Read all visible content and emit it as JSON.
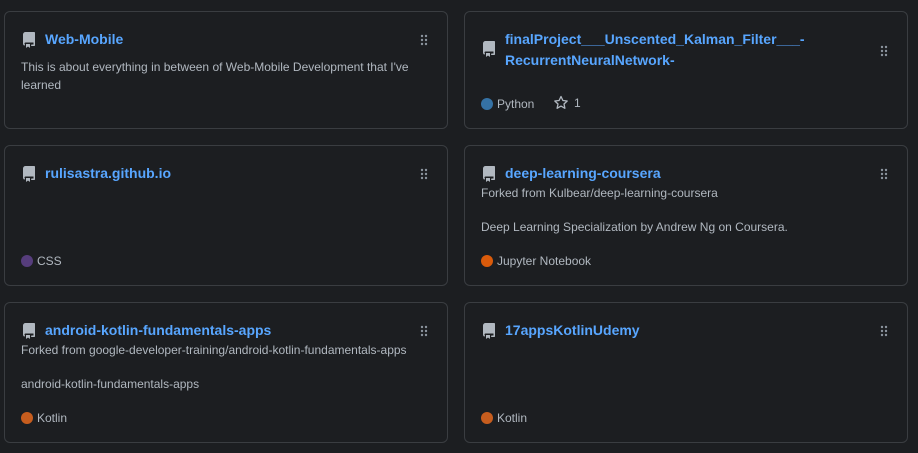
{
  "colors": {
    "link": "#58a6ff",
    "python": "#3572A5",
    "css": "#563d7c",
    "jupyter": "#DA5B0B",
    "kotlin": "#c65d1e"
  },
  "repos": [
    {
      "name": "Web-Mobile",
      "description": "This is about everything in between of Web-Mobile Development that I've learned"
    },
    {
      "name_line1": "finalProject___Unscented_Kalman_Filter___-",
      "name_line2": "RecurrentNeuralNetwork-",
      "language": "Python",
      "stars": "1"
    },
    {
      "name": "rulisastra.github.io",
      "language": "CSS"
    },
    {
      "name": "deep-learning-coursera",
      "forked_from": "Forked from Kulbear/deep-learning-coursera",
      "description": "Deep Learning Specialization by Andrew Ng on Coursera.",
      "language": "Jupyter Notebook"
    },
    {
      "name": "android-kotlin-fundamentals-apps",
      "forked_from": "Forked from google-developer-training/android-kotlin-fundamentals-apps",
      "description": "android-kotlin-fundamentals-apps",
      "language": "Kotlin"
    },
    {
      "name": "17appsKotlinUdemy",
      "language": "Kotlin"
    }
  ]
}
